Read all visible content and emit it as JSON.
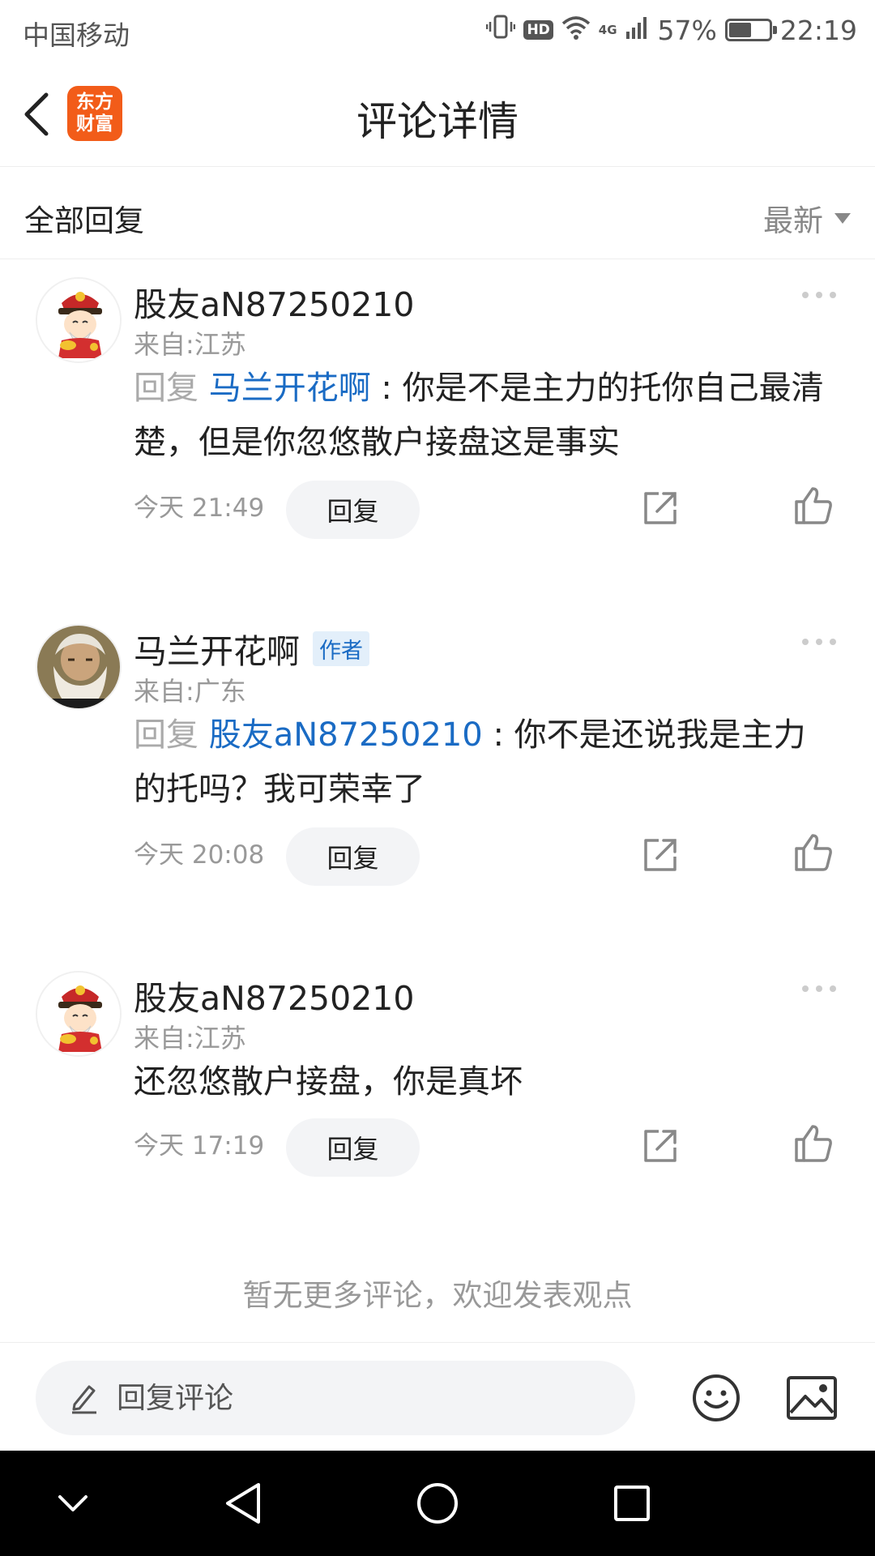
{
  "status_bar": {
    "carrier": "中国移动",
    "hd": "HD",
    "network": "4G",
    "battery_percent": "57%",
    "battery_level": 0.57,
    "time": "22:19"
  },
  "nav": {
    "title": "评论详情",
    "logo_line1": "东方",
    "logo_line2": "财富",
    "logo_color": "#f25c19"
  },
  "filter": {
    "title": "全部回复",
    "sort_label": "最新"
  },
  "comments": [
    {
      "username": "股友aN87250210",
      "location": "来自:江苏",
      "reply_prefix": "回复",
      "reply_to": "马兰开花啊",
      "separator": " : ",
      "text": "你是不是主力的托你自己最清楚，但是你忽悠散户接盘这是事实",
      "time": "今天 21:49",
      "reply_label": "回复",
      "avatar_icon": "cartoon-god-of-wealth-avatar"
    },
    {
      "username": "马兰开花啊",
      "badge": "作者",
      "location": "来自:广东",
      "reply_prefix": "回复",
      "reply_to": "股友aN87250210",
      "separator": " : ",
      "text": "你不是还说我是主力的托吗？我可荣幸了",
      "time": "今天 20:08",
      "reply_label": "回复",
      "avatar_icon": "bearded-man-portrait-avatar"
    },
    {
      "username": "股友aN87250210",
      "location": "来自:江苏",
      "text": "还忽悠散户接盘，你是真坏",
      "time": "今天 17:19",
      "reply_label": "回复",
      "avatar_icon": "cartoon-god-of-wealth-avatar"
    }
  ],
  "footer_note": "暂无更多评论，欢迎发表观点",
  "bottom_bar": {
    "input_placeholder": "回复评论"
  },
  "colors": {
    "link_blue": "#1a6bc4",
    "meta_gray": "#999999"
  }
}
